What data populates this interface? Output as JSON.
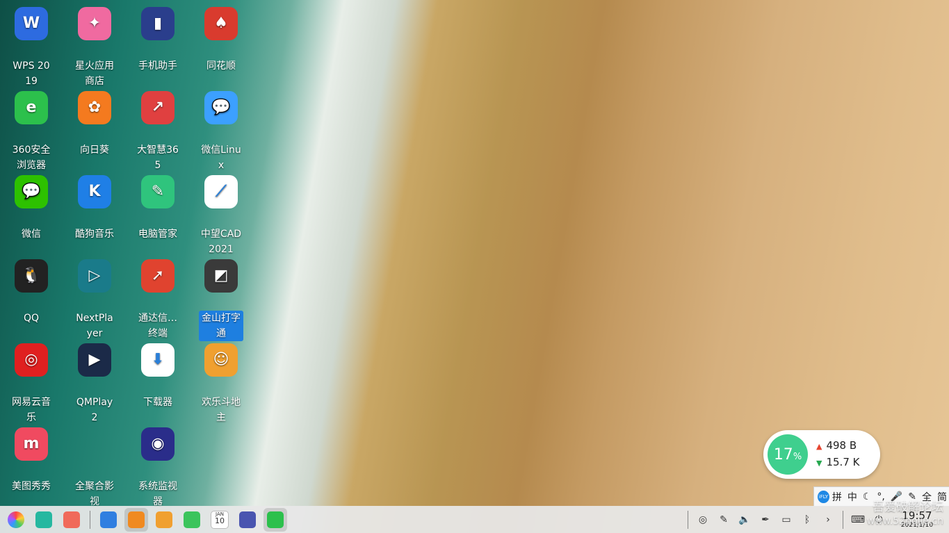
{
  "desktop": {
    "icons": [
      {
        "label": "WPS 2019",
        "icon": "wps-icon",
        "color": "#2d6be0",
        "glyph": "W"
      },
      {
        "label": "星火应用商店",
        "icon": "spark-store-icon",
        "color": "#f06aa0",
        "glyph": "✦"
      },
      {
        "label": "手机助手",
        "icon": "phone-assistant-icon",
        "color": "#2a3e8c",
        "glyph": "▮"
      },
      {
        "label": "同花顺",
        "icon": "tonghuashun-icon",
        "color": "#d93b2e",
        "glyph": "♠"
      },
      {
        "label": "360安全浏览器",
        "icon": "360-browser-icon",
        "color": "#2cc04c",
        "glyph": "e"
      },
      {
        "label": "向日葵",
        "icon": "sunflower-icon",
        "color": "#f47a1f",
        "glyph": "✿"
      },
      {
        "label": "大智慧365",
        "icon": "dazhihui-icon",
        "color": "#e04040",
        "glyph": "↗"
      },
      {
        "label": "微信Linux",
        "icon": "wechat-linux-icon",
        "color": "#3ca0ff",
        "glyph": "💬"
      },
      {
        "label": "微信",
        "icon": "wechat-icon",
        "color": "#2dc100",
        "glyph": "💬"
      },
      {
        "label": "酷狗音乐",
        "icon": "kugou-icon",
        "color": "#1f7fe6",
        "glyph": "K"
      },
      {
        "label": "电脑管家",
        "icon": "pc-manager-icon",
        "color": "#2fc47d",
        "glyph": "✎"
      },
      {
        "label": "中望CAD 2021",
        "icon": "zwcad-icon",
        "color": "#ffffff",
        "glyph": "⟋"
      },
      {
        "label": "QQ",
        "icon": "qq-icon",
        "color": "#222222",
        "glyph": "🐧"
      },
      {
        "label": "NextPlayer",
        "icon": "nextplayer-icon",
        "color": "#1a7b8a",
        "glyph": "▷"
      },
      {
        "label": "通达信…终端",
        "icon": "tongdaxin-icon",
        "color": "#e0432f",
        "glyph": "➚"
      },
      {
        "label": "金山打字通",
        "icon": "typing-icon",
        "color": "#3a3a3a",
        "glyph": "◩"
      },
      {
        "label": "网易云音乐",
        "icon": "netease-music-icon",
        "color": "#e02020",
        "glyph": "◎"
      },
      {
        "label": "QMPlay2",
        "icon": "qmplay2-icon",
        "color": "#1b2a48",
        "glyph": "▶"
      },
      {
        "label": "下载器",
        "icon": "downloader-icon",
        "color": "#ffffff",
        "glyph": "⬇"
      },
      {
        "label": "欢乐斗地主",
        "icon": "doudizhu-icon",
        "color": "#f0a030",
        "glyph": "☺"
      },
      {
        "label": "美图秀秀",
        "icon": "meitu-icon",
        "color": "#f04a60",
        "glyph": "m"
      },
      {
        "label": "全聚合影视",
        "icon": "video-aggregator-icon",
        "color": "transparent",
        "glyph": ""
      },
      {
        "label": "系统监视器",
        "icon": "system-monitor-icon",
        "color": "#2a2d8a",
        "glyph": "◉"
      }
    ],
    "selected_label": "金山打字通"
  },
  "netmon": {
    "cpu_value": "17",
    "cpu_unit": "%",
    "upload": "498 B",
    "download": "15.7 K",
    "accent": "#3fcf8e"
  },
  "ime": {
    "logo": "iFLY",
    "items": [
      "拼",
      "中",
      "☾",
      "°,",
      "🎤",
      "✎",
      "全",
      "简"
    ]
  },
  "taskbar": {
    "apps": [
      {
        "icon": "launcher-icon",
        "color": "conic"
      },
      {
        "icon": "multitask-view-icon",
        "color": "#25b8a0"
      },
      {
        "icon": "workspace-icon",
        "color": "#f06a5a"
      },
      {
        "icon": "file-manager-icon",
        "color": "#2f7fe0"
      },
      {
        "icon": "app-store-icon",
        "color": "#f08a20"
      },
      {
        "icon": "image-viewer-icon",
        "color": "#f0a030"
      },
      {
        "icon": "music-icon",
        "color": "#3bc45c"
      },
      {
        "icon": "calendar-icon",
        "color": "#ffffff"
      },
      {
        "icon": "settings-icon",
        "color": "#4a55b0"
      },
      {
        "icon": "browser-icon",
        "color": "#2cc04c"
      }
    ],
    "tray": [
      {
        "icon": "ifly-tray-icon",
        "glyph": "◎"
      },
      {
        "icon": "brush-tray-icon",
        "glyph": "✎"
      },
      {
        "icon": "volume-icon",
        "glyph": "🔈"
      },
      {
        "icon": "pen-tray-icon",
        "glyph": "✒"
      },
      {
        "icon": "battery-icon",
        "glyph": "▭"
      },
      {
        "icon": "bluetooth-icon",
        "glyph": "ᛒ"
      },
      {
        "icon": "chevron-right-icon",
        "glyph": "›"
      },
      {
        "icon": "keyboard-icon",
        "glyph": "⌨"
      },
      {
        "icon": "power-icon",
        "glyph": "⏻"
      }
    ],
    "time": "19:57",
    "date": "2021/1/10",
    "calendar_month": "JAN",
    "calendar_day": "10"
  },
  "watermark": {
    "line1": "吾爱破解论坛",
    "line2": "www.52pojie.cn"
  }
}
